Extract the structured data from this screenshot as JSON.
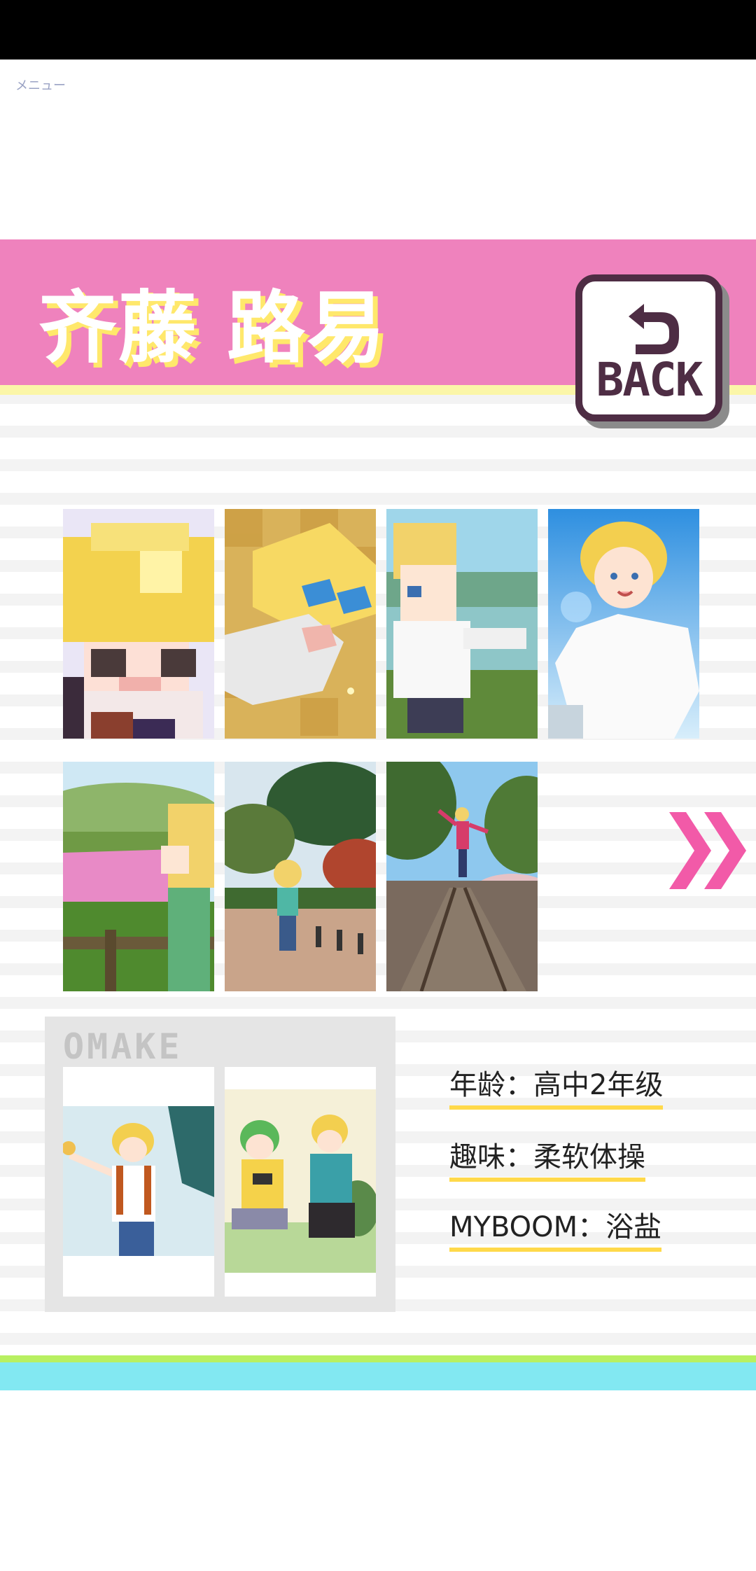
{
  "menu": {
    "label": "メニュー"
  },
  "header": {
    "title": "齐藤 路易"
  },
  "back_button": {
    "label": "BACK"
  },
  "gallery": {
    "row1": [
      {
        "name": "pixel-face-closeup"
      },
      {
        "name": "pixel-face-gold-tiles"
      },
      {
        "name": "pixel-character-by-lake"
      },
      {
        "name": "boy-in-sky"
      }
    ],
    "row2": [
      {
        "name": "pixel-character-flower-field"
      },
      {
        "name": "boy-in-park"
      },
      {
        "name": "person-on-railway"
      }
    ]
  },
  "omake": {
    "title": "OMAKE"
  },
  "profile": {
    "age": "年龄：高中2年级",
    "hobby": "趣味：柔软体操",
    "myboom": "MYBOOM：浴盐"
  },
  "colors": {
    "banner": "#ef82bd",
    "title_shadow": "#ffe86b",
    "back_border": "#4e2d44",
    "arrow": "#f25aa8",
    "underline": "#ffd94a",
    "footer_green": "#b8f061",
    "footer_cyan": "#82e8f2"
  }
}
